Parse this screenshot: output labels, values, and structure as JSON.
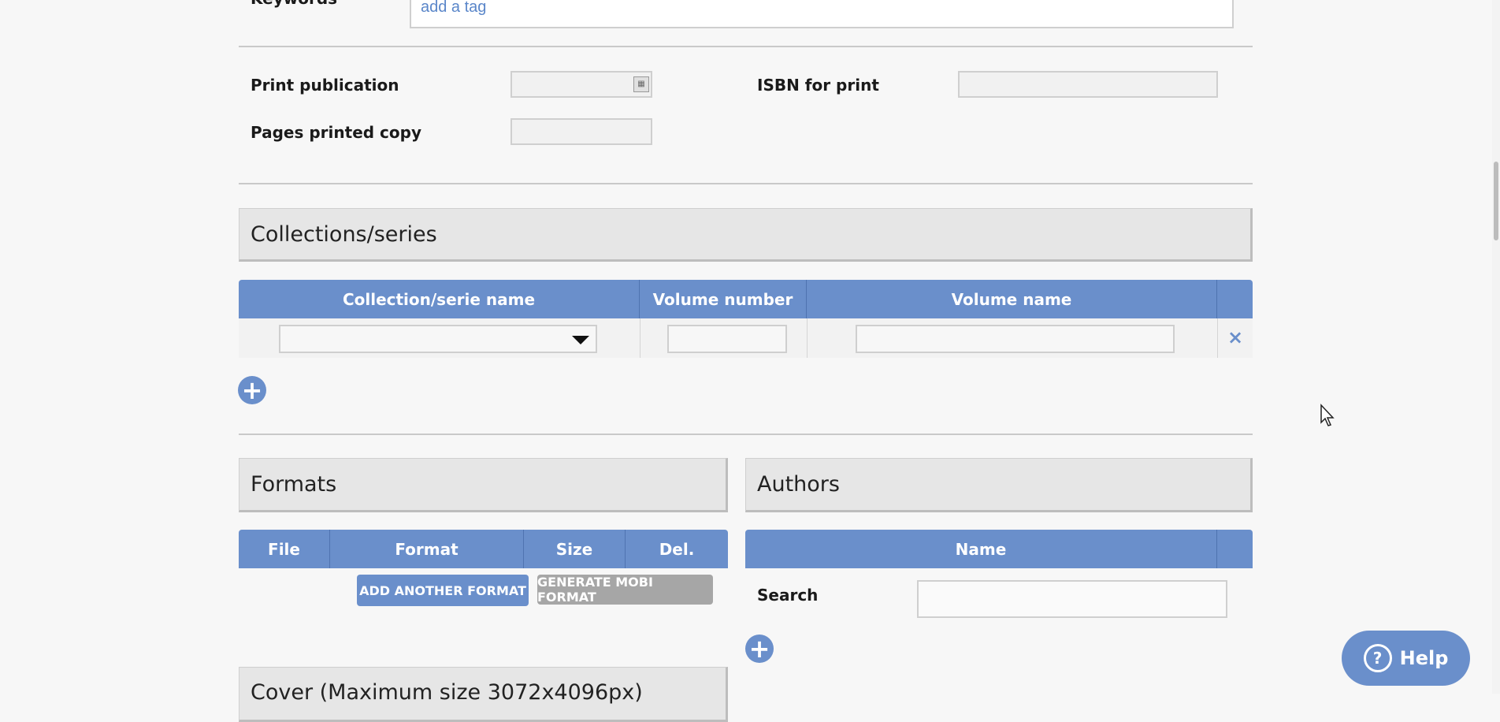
{
  "keywords": {
    "label": "Keywords",
    "placeholder": "add a tag"
  },
  "print": {
    "publication_label": "Print publication",
    "pages_label": "Pages printed copy",
    "isbn_label": "ISBN for print"
  },
  "collections": {
    "title": "Collections/series",
    "columns": [
      "Collection/serie name",
      "Volume number",
      "Volume name"
    ],
    "remove_icon": "×"
  },
  "formats": {
    "title": "Formats",
    "columns": [
      "File",
      "Format",
      "Size",
      "Del."
    ],
    "add_button": "ADD ANOTHER FORMAT",
    "mobi_button": "GENERATE MOBI FORMAT"
  },
  "authors": {
    "title": "Authors",
    "columns": [
      "Name"
    ],
    "search_label": "Search"
  },
  "cover": {
    "title": "Cover (Maximum size 3072x4096px)"
  },
  "help": {
    "label": "Help"
  },
  "colors": {
    "accent": "#6a8fcb",
    "disabled": "#a6a6a6"
  }
}
